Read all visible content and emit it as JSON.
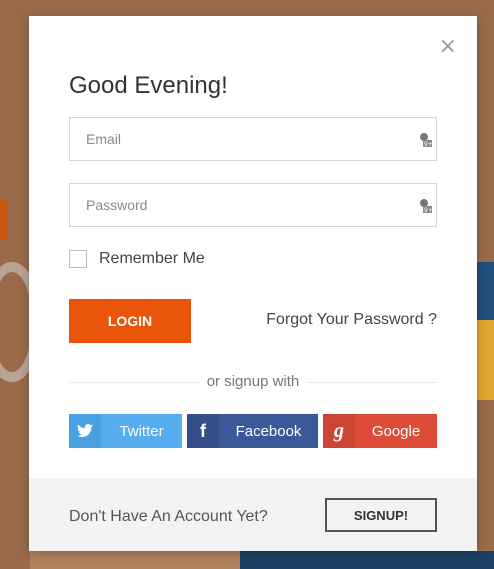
{
  "modal": {
    "close_glyph": "×",
    "title": "Good Evening!",
    "email": {
      "placeholder": "Email",
      "value": ""
    },
    "password": {
      "placeholder": "Password",
      "value": ""
    },
    "remember_label": "Remember Me",
    "remember_checked": false,
    "login_label": "LOGIN",
    "forgot_label": "Forgot Your Password ?",
    "divider_label": "or signup with",
    "social": {
      "twitter": {
        "label": "Twitter",
        "icon": "twitter-icon",
        "glyph": "t",
        "color": "#55acee"
      },
      "facebook": {
        "label": "Facebook",
        "icon": "facebook-icon",
        "glyph": "f",
        "color": "#3b5998"
      },
      "google": {
        "label": "Google",
        "icon": "google-icon",
        "glyph": "g",
        "color": "#dd4b39"
      }
    },
    "footer": {
      "text": "Don't Have An Account Yet?",
      "signup_label": "SIGNUP!"
    },
    "accent_color": "#e8540a"
  }
}
